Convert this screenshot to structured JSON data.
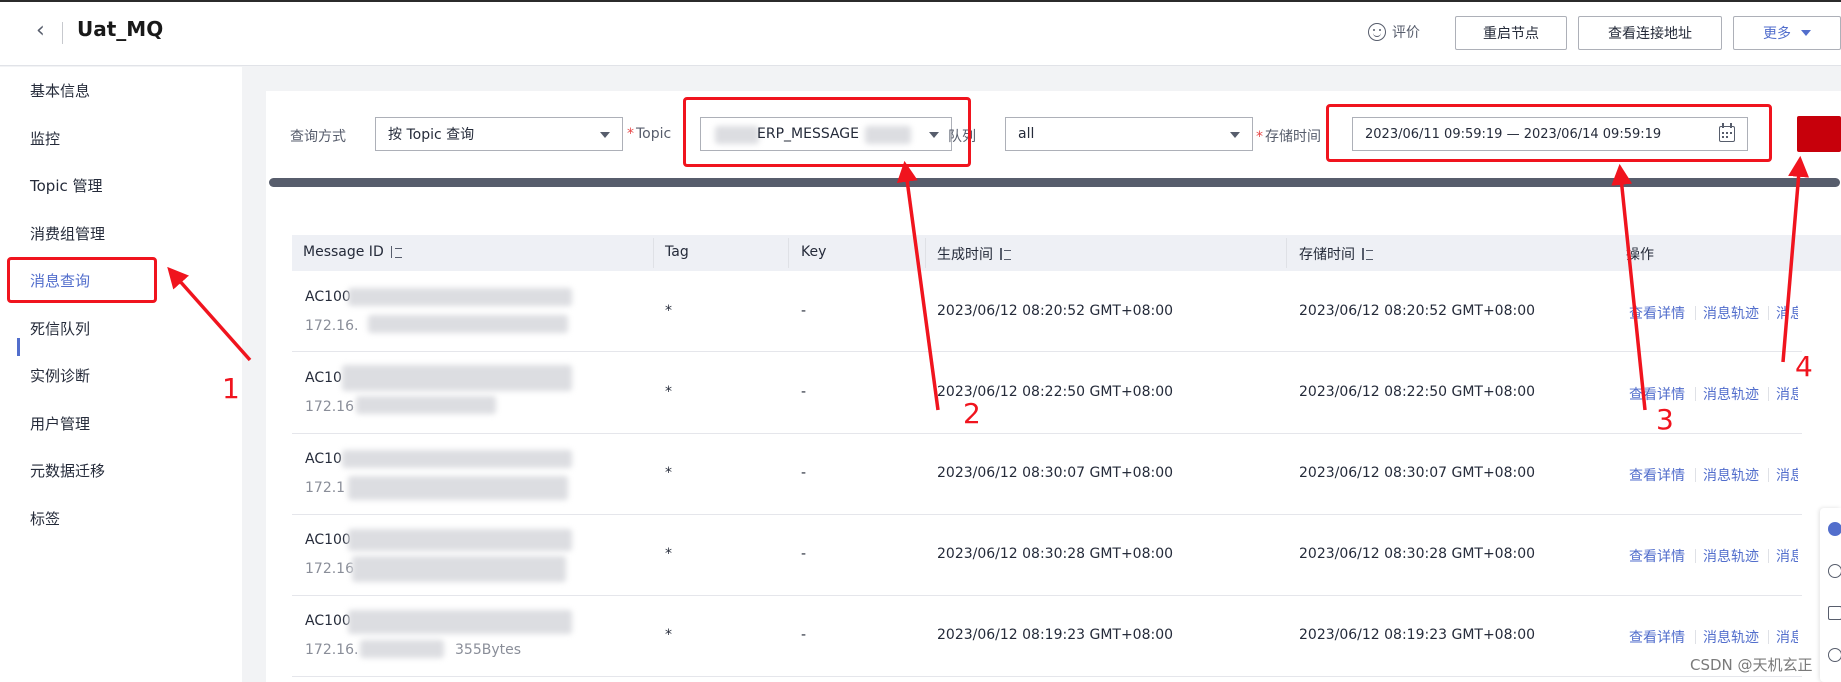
{
  "header": {
    "title": "Uat_MQ",
    "rate_label": "评价",
    "restart_label": "重启节点",
    "conn_label": "查看连接地址",
    "more_label": "更多"
  },
  "sidebar": {
    "items": [
      {
        "label": "基本信息"
      },
      {
        "label": "监控"
      },
      {
        "label": "Topic 管理"
      },
      {
        "label": "消费组管理"
      },
      {
        "label": "消息查询",
        "active": true
      },
      {
        "label": "死信队列"
      },
      {
        "label": "实例诊断"
      },
      {
        "label": "用户管理"
      },
      {
        "label": "元数据迁移"
      },
      {
        "label": "标签"
      }
    ]
  },
  "filter": {
    "mode_label": "查询方式",
    "mode_value": "按 Topic 查询",
    "topic_label": "Topic",
    "topic_value": "ERP_MESSAGE",
    "queue_label": "队列",
    "queue_value": "all",
    "time_label": "存储时间",
    "time_value": "2023/06/11 09:59:19 — 2023/06/14 09:59:19"
  },
  "table": {
    "headers": {
      "message_id": "Message ID",
      "tag": "Tag",
      "key": "Key",
      "born_time": "生成时间",
      "store_time": "存储时间",
      "ops": "操作"
    },
    "rows": [
      {
        "id_prefix": "AC100",
        "host": "172.16.",
        "tag": "*",
        "key": "-",
        "born": "2023/06/12 08:20:52 GMT+08:00",
        "store": "2023/06/12 08:20:52 GMT+08:00"
      },
      {
        "id_prefix": "AC10",
        "host": "172.16",
        "tag": "*",
        "key": "-",
        "born": "2023/06/12 08:22:50 GMT+08:00",
        "store": "2023/06/12 08:22:50 GMT+08:00"
      },
      {
        "id_prefix": "AC10",
        "host": "172.1",
        "tag": "*",
        "key": "-",
        "born": "2023/06/12 08:30:07 GMT+08:00",
        "store": "2023/06/12 08:30:07 GMT+08:00"
      },
      {
        "id_prefix": "AC100",
        "host": "172.16",
        "tag": "*",
        "key": "-",
        "born": "2023/06/12 08:30:28 GMT+08:00",
        "store": "2023/06/12 08:30:28 GMT+08:00"
      },
      {
        "id_prefix": "AC100",
        "host": "172.16.",
        "size": "355Bytes",
        "tag": "*",
        "key": "-",
        "born": "2023/06/12 08:19:23 GMT+08:00",
        "store": "2023/06/12 08:19:23 GMT+08:00"
      }
    ],
    "op_labels": {
      "detail": "查看详情",
      "trace": "消息轨迹",
      "more": "消息"
    }
  },
  "annotations": {
    "n1": "1",
    "n2": "2",
    "n3": "3",
    "n4": "4"
  },
  "watermark": "CSDN @天机玄正",
  "colors": {
    "accent": "#526ecc",
    "primary_red": "#c7000b",
    "annotation_red": "#f0141e"
  }
}
